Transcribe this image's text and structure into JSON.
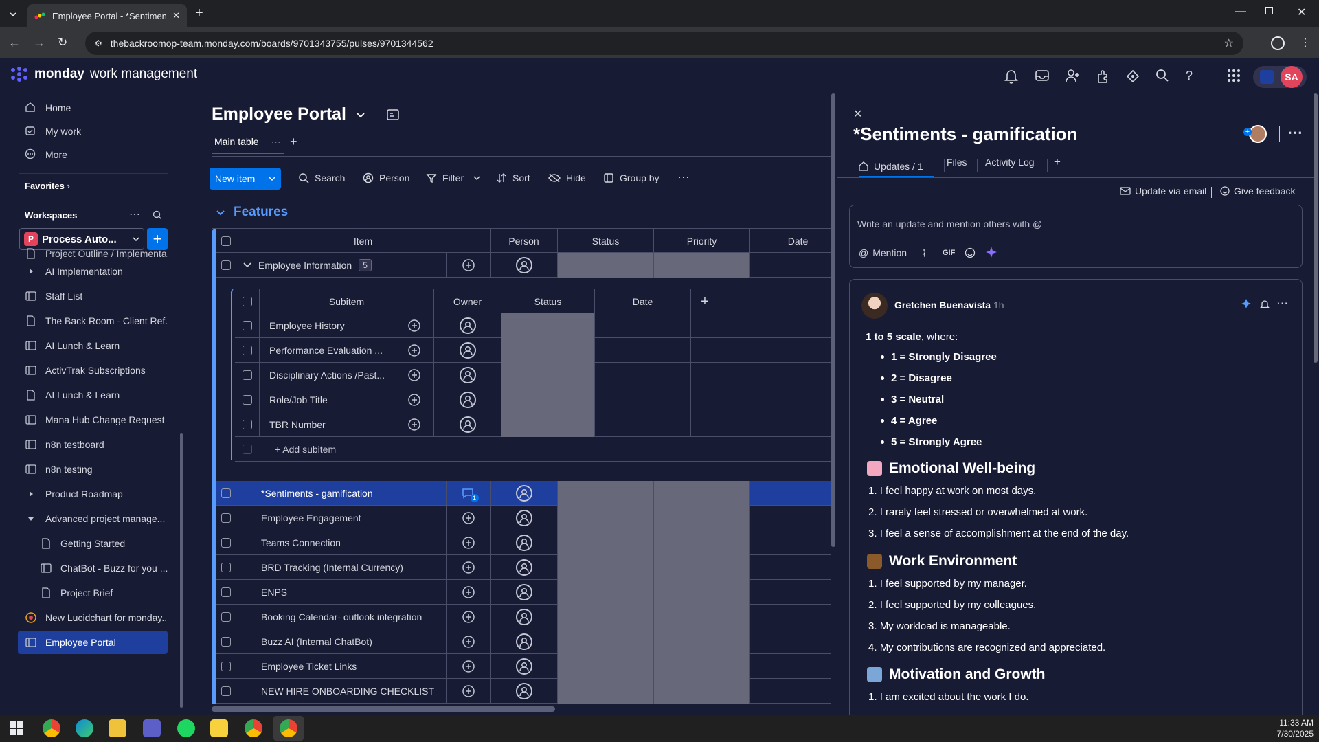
{
  "browser": {
    "tab_title": "Employee Portal - *Sentiments",
    "url": "thebackroomop-team.monday.com/boards/9701343755/pulses/9701344562"
  },
  "app": {
    "brand_bold": "monday",
    "brand_rest": "work management",
    "avatar_initials": "SA"
  },
  "sidebar": {
    "top": [
      {
        "label": "Home",
        "icon": "home-icon"
      },
      {
        "label": "My work",
        "icon": "calendar-icon"
      },
      {
        "label": "More",
        "icon": "more-circle-icon"
      }
    ],
    "favorites_label": "Favorites",
    "workspaces_label": "Workspaces",
    "workspace_name": "Process Auto...",
    "workspace_badge": "P",
    "items": [
      {
        "label": "Project Outline / Implementa...",
        "icon": "doc-icon"
      },
      {
        "label": "AI Implementation",
        "icon": "folder-arrow"
      },
      {
        "label": "Staff List",
        "icon": "board-icon"
      },
      {
        "label": "The Back Room - Client Ref...",
        "icon": "doc-icon"
      },
      {
        "label": "AI Lunch & Learn",
        "icon": "board-icon"
      },
      {
        "label": "ActivTrak Subscriptions",
        "icon": "board-icon"
      },
      {
        "label": "AI Lunch & Learn",
        "icon": "doc-icon"
      },
      {
        "label": "Mana Hub Change Request",
        "icon": "board-icon"
      },
      {
        "label": "n8n testboard",
        "icon": "board-icon"
      },
      {
        "label": "n8n testing",
        "icon": "board-icon"
      },
      {
        "label": "Product Roadmap",
        "icon": "folder-arrow"
      },
      {
        "label": "Advanced project manage...",
        "icon": "folder-open"
      },
      {
        "label": "Getting Started",
        "icon": "doc-icon"
      },
      {
        "label": "ChatBot - Buzz for you ...",
        "icon": "board-icon"
      },
      {
        "label": "Project Brief",
        "icon": "doc-icon"
      },
      {
        "label": "New Lucidchart for monday...",
        "icon": "lucid-icon"
      },
      {
        "label": "Employee Portal",
        "icon": "board-icon"
      }
    ]
  },
  "board": {
    "title": "Employee Portal",
    "view_tab": "Main table",
    "toolbar": {
      "new_item": "New item",
      "search": "Search",
      "person": "Person",
      "filter": "Filter",
      "sort": "Sort",
      "hide": "Hide",
      "group_by": "Group by"
    },
    "group_title": "Features",
    "columns": [
      "Item",
      "Person",
      "Status",
      "Priority",
      "Date"
    ],
    "parent_item": {
      "name": "Employee Information",
      "count": "5"
    },
    "subitem_columns": [
      "Subitem",
      "Owner",
      "Status",
      "Date"
    ],
    "subitems": [
      "Employee History",
      "Performance Evaluation ...",
      "Disciplinary Actions /Past...",
      "Role/Job Title",
      "TBR Number"
    ],
    "add_subitem": "+ Add subitem",
    "items": [
      {
        "name": "*Sentiments - gamification",
        "selected": true,
        "updates": "1"
      },
      {
        "name": "Employee Engagement"
      },
      {
        "name": "Teams Connection"
      },
      {
        "name": "BRD Tracking (Internal Currency)"
      },
      {
        "name": "ENPS"
      },
      {
        "name": "Booking Calendar- outlook integration"
      },
      {
        "name": "Buzz AI (Internal ChatBot)"
      },
      {
        "name": "Employee Ticket Links"
      },
      {
        "name": "NEW HIRE ONBOARDING CHECKLIST"
      }
    ]
  },
  "panel": {
    "title": "*Sentiments - gamification",
    "tabs": [
      "Updates / 1",
      "Files",
      "Activity Log"
    ],
    "update_via_email": "Update via email",
    "give_feedback": "Give feedback",
    "editor_placeholder": "Write an update and mention others with @",
    "mention": "Mention",
    "gif": "GIF",
    "author": "Gretchen Buenavista",
    "time": "1h",
    "scale_bold": "1 to 5 scale",
    "scale_rest": ", where:",
    "scale": [
      "1 = Strongly Disagree",
      "2 = Disagree",
      "3 = Neutral",
      "4 = Agree",
      "5 = Strongly Agree"
    ],
    "sections": [
      {
        "title": "Emotional Well-being",
        "emoji": "brain-emoji",
        "items": [
          "I feel happy at work on most days.",
          "I rarely feel stressed or overwhelmed at work.",
          "I feel a sense of accomplishment at the end of the day."
        ]
      },
      {
        "title": "Work Environment",
        "emoji": "briefcase-emoji",
        "items": [
          "I feel supported by my manager.",
          "I feel supported by my colleagues.",
          "My workload is manageable.",
          "My contributions are recognized and appreciated."
        ]
      },
      {
        "title": "Motivation and Growth",
        "emoji": "rocket-emoji",
        "items": [
          "I am excited about the work I do."
        ]
      }
    ]
  },
  "taskbar": {
    "time": "11:33 AM",
    "date": "7/30/2025"
  }
}
